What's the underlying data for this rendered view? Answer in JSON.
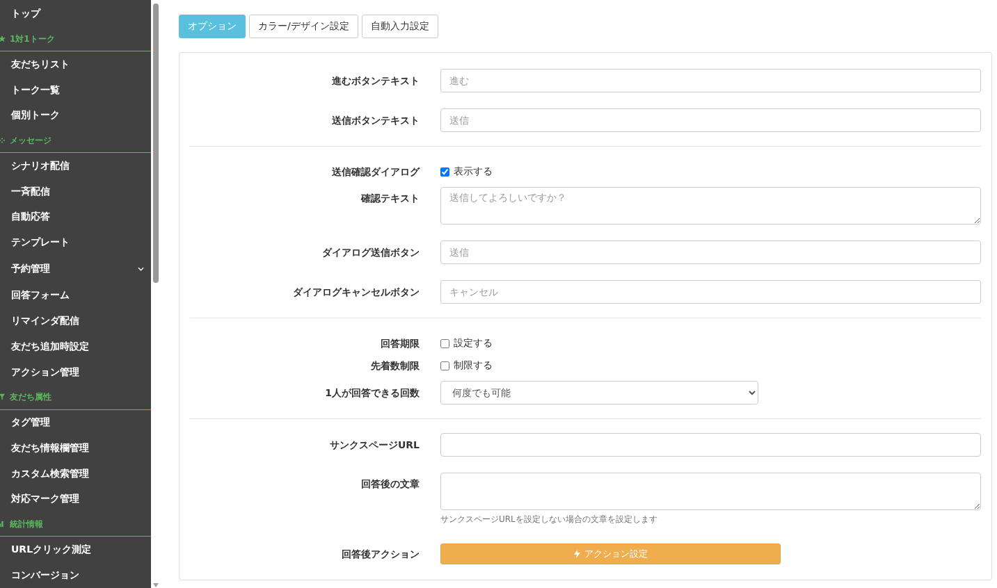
{
  "sidebar": {
    "items": [
      {
        "kind": "item",
        "label": "トップ"
      },
      {
        "kind": "section",
        "label": "1対1トーク"
      },
      {
        "kind": "item",
        "label": "友だちリスト"
      },
      {
        "kind": "item",
        "label": "トーク一覧"
      },
      {
        "kind": "item",
        "label": "個別トーク"
      },
      {
        "kind": "section",
        "label": "メッセージ"
      },
      {
        "kind": "item",
        "label": "シナリオ配信"
      },
      {
        "kind": "item",
        "label": "一斉配信"
      },
      {
        "kind": "item",
        "label": "自動応答"
      },
      {
        "kind": "item",
        "label": "テンプレート"
      },
      {
        "kind": "group",
        "label": "予約管理",
        "expanded": false
      },
      {
        "kind": "item",
        "label": "回答フォーム"
      },
      {
        "kind": "item",
        "label": "リマインダ配信"
      },
      {
        "kind": "item",
        "label": "友だち追加時設定"
      },
      {
        "kind": "item",
        "label": "アクション管理"
      },
      {
        "kind": "section",
        "label": "友だち属性"
      },
      {
        "kind": "item",
        "label": "タグ管理"
      },
      {
        "kind": "item",
        "label": "友だち情報欄管理"
      },
      {
        "kind": "item",
        "label": "カスタム検索管理"
      },
      {
        "kind": "item",
        "label": "対応マーク管理"
      },
      {
        "kind": "section",
        "label": "統計情報"
      },
      {
        "kind": "item",
        "label": "URLクリック測定"
      },
      {
        "kind": "item",
        "label": "コンバージョン"
      }
    ]
  },
  "tabs": [
    {
      "label": "オプション",
      "selected": true
    },
    {
      "label": "カラー/デザイン設定",
      "selected": false
    },
    {
      "label": "自動入力設定",
      "selected": false
    }
  ],
  "form": {
    "sections": [
      {
        "rows": [
          {
            "kind": "text",
            "label": "進むボタンテキスト",
            "placeholder": "進む"
          },
          {
            "kind": "text",
            "label": "送信ボタンテキスト",
            "placeholder": "送信"
          }
        ]
      },
      {
        "rows": [
          {
            "kind": "checkbox",
            "label": "送信確認ダイアログ",
            "option": "表示する",
            "checked": true
          },
          {
            "kind": "textarea",
            "label": "確認テキスト",
            "placeholder": "送信してよろしいですか？"
          },
          {
            "kind": "text",
            "label": "ダイアログ送信ボタン",
            "placeholder": "送信"
          },
          {
            "kind": "text",
            "label": "ダイアログキャンセルボタン",
            "placeholder": "キャンセル"
          }
        ]
      },
      {
        "rows": [
          {
            "kind": "checkbox",
            "label": "回答期限",
            "option": "設定する",
            "checked": false
          },
          {
            "kind": "checkbox",
            "label": "先着数制限",
            "option": "制限する",
            "checked": false
          },
          {
            "kind": "select",
            "label": "1人が回答できる回数",
            "value": "何度でも可能"
          }
        ]
      },
      {
        "rows": [
          {
            "kind": "text",
            "label": "サンクスページURL"
          },
          {
            "kind": "textarea",
            "label": "回答後の文章",
            "help": "サンクスページURLを設定しない場合の文章を設定します"
          },
          {
            "kind": "button",
            "label": "回答後アクション",
            "button": "アクション設定"
          }
        ]
      }
    ]
  }
}
